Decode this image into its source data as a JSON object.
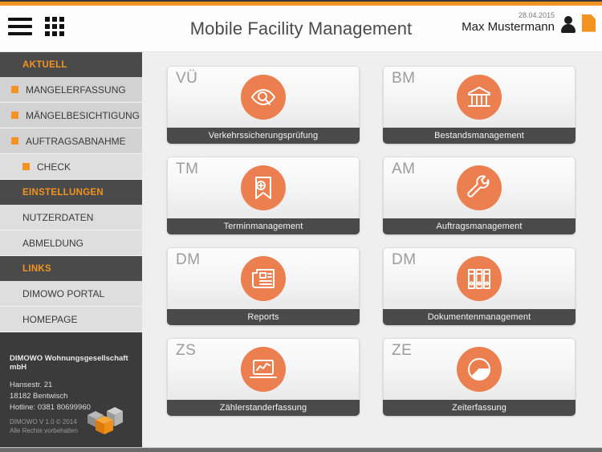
{
  "header": {
    "title": "Mobile Facility Management",
    "date": "28.04.2015",
    "user": "Max Mustermann",
    "menu_icon": "hamburger-icon",
    "apps_icon": "grid-icon",
    "person_icon": "person-icon",
    "document_icon": "document-icon"
  },
  "sidebar": {
    "groups": [
      {
        "title": "AKTUELL",
        "items": [
          {
            "label": "MANGELERFASSUNG",
            "bullet": true,
            "style": "dark"
          },
          {
            "label": "MÄNGELBESICHTIGUNG",
            "bullet": true,
            "style": "dark"
          },
          {
            "label": "AUFTRAGSABNAHME",
            "bullet": true,
            "style": "dark"
          },
          {
            "label": "CHECK",
            "bullet": true,
            "style": "light"
          }
        ]
      },
      {
        "title": "EINSTELLUNGEN",
        "items": [
          {
            "label": "NUTZERDATEN",
            "bullet": false,
            "style": "light"
          },
          {
            "label": "ABMELDUNG",
            "bullet": false,
            "style": "light"
          }
        ]
      },
      {
        "title": "LINKS",
        "items": [
          {
            "label": "DIMOWO PORTAL",
            "bullet": false,
            "style": "light"
          },
          {
            "label": "HOMEPAGE",
            "bullet": false,
            "style": "light"
          }
        ]
      }
    ],
    "footer": {
      "company": "DIMOWO Wohnungsgesellschaft mbH",
      "street": "Hansestr. 21",
      "city": "18182 Bentwisch",
      "hotline": "Hotline: 0381 80699960",
      "version": "DIMOWO V 1.0 © 2014",
      "rights": "Alle Rechte vorbehalten",
      "logo_icon": "cubes-logo-icon"
    }
  },
  "main": {
    "cards": [
      {
        "code": "VÜ",
        "label": "Verkehrssicherungsprüfung",
        "icon": "eye-search-icon"
      },
      {
        "code": "BM",
        "label": "Bestandsmanagement",
        "icon": "bank-columns-icon"
      },
      {
        "code": "TM",
        "label": "Terminmanagement",
        "icon": "bookmark-plus-icon"
      },
      {
        "code": "AM",
        "label": "Auftragsmanagement",
        "icon": "wrench-icon"
      },
      {
        "code": "DM",
        "label": "Reports",
        "icon": "newspaper-icon"
      },
      {
        "code": "DM",
        "label": "Dokumentenmanagement",
        "icon": "binders-icon"
      },
      {
        "code": "ZS",
        "label": "Zählerstanderfassung",
        "icon": "laptop-chart-icon"
      },
      {
        "code": "ZE",
        "label": "Zeiterfassung",
        "icon": "pie-chart-icon"
      }
    ]
  },
  "colors": {
    "accent": "#f39322",
    "icon_circle": "#ec7f4f",
    "dark_panel": "#3b3b3b",
    "label_bar": "#4a4a4a"
  }
}
